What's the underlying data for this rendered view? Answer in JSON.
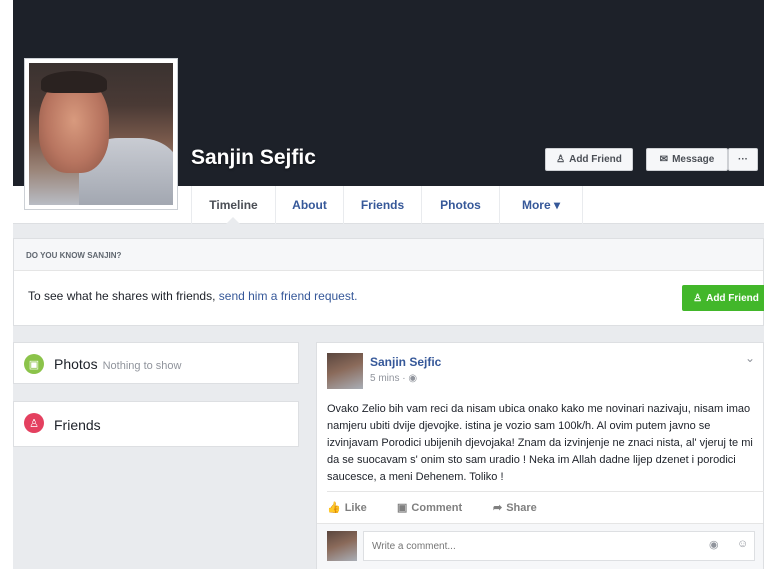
{
  "profile": {
    "name": "Sanjin Sejfic",
    "buttons": {
      "add_friend": "Add Friend",
      "message": "Message",
      "more": "···"
    },
    "tabs": [
      "Timeline",
      "About",
      "Friends",
      "Photos",
      "More ▾"
    ],
    "active_tab": "Timeline"
  },
  "know": {
    "header": "DO YOU KNOW SANJIN?",
    "text_before": "To see what he shares with friends, ",
    "link": "send him a friend request.",
    "button": "Add Friend"
  },
  "sidebar": {
    "photos_title": "Photos",
    "photos_sub": "Nothing to show",
    "friends_title": "Friends"
  },
  "post": {
    "author": "Sanjin Sejfic",
    "time": "5 mins · ◉",
    "text": "Ovako Zelio bih vam reci da nisam ubica onako kako me novinari nazivaju, nisam imao namjeru ubiti dvije djevojke. istina je vozio sam 100k/h. Al ovim putem javno se izvinjavam Porodici ubijenih djevojaka! Znam da izvinjenje ne znaci nista, al' vjeruj te mi da se suocavam s' onim sto sam uradio ! Neka im Allah dadne lijep dzenet i porodici saucesce, a meni Dehenem. Toliko !",
    "actions": {
      "like": "Like",
      "comment": "Comment",
      "share": "Share"
    },
    "comment_placeholder": "Write a comment..."
  },
  "colors": {
    "cover": "#1d2129",
    "link": "#365899",
    "green": "#42b72a",
    "photos_icon": "#8bc34a",
    "friends_icon": "#e4405f"
  }
}
